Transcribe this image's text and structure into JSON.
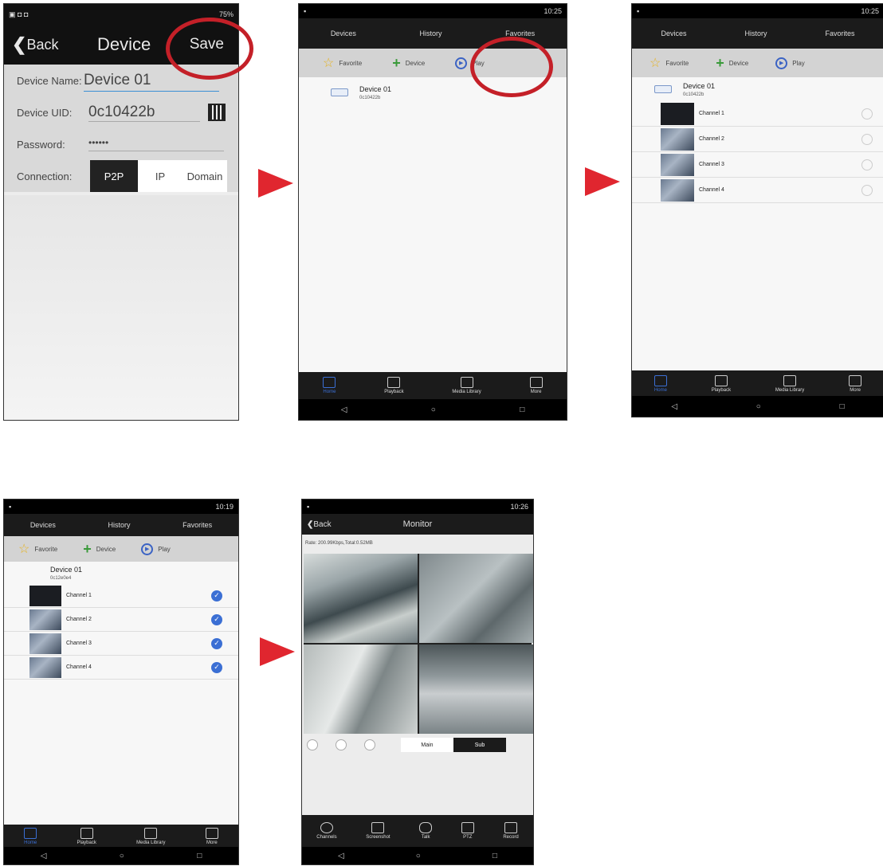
{
  "screen1": {
    "status": "75%",
    "back": "Back",
    "title": "Device",
    "save": "Save",
    "name_label": "Device Name:",
    "name_value": "Device 01",
    "uid_label": "Device UID:",
    "uid_value": "0c10422b",
    "password_label": "Password:",
    "password_value": "••••••",
    "connection_label": "Connection:",
    "conn_options": [
      "P2P",
      "IP",
      "Domain"
    ]
  },
  "screen2": {
    "clock": "10:25",
    "tabs": [
      "Devices",
      "History",
      "Favorites"
    ],
    "favorite": "Favorite",
    "device": "Device",
    "play": "Play",
    "device_name": "Device 01",
    "device_uid": "0c10422b",
    "bottom": [
      "Home",
      "Playback",
      "Media Library",
      "More"
    ]
  },
  "screen3": {
    "clock": "10:25",
    "tabs": [
      "Devices",
      "History",
      "Favorites"
    ],
    "favorite": "Favorite",
    "device": "Device",
    "play": "Play",
    "device_name": "Device 01",
    "device_uid": "0c10422b",
    "channels": [
      "Channel 1",
      "Channel 2",
      "Channel 3",
      "Channel 4"
    ],
    "bottom": [
      "Home",
      "Playback",
      "Media Library",
      "More"
    ]
  },
  "screen4": {
    "clock": "10:19",
    "tabs": [
      "Devices",
      "History",
      "Favorites"
    ],
    "favorite": "Favorite",
    "device": "Device",
    "play": "Play",
    "device_name": "Device 01",
    "device_uid": "0c12e0e4",
    "channels": [
      "Channel 1",
      "Channel 2",
      "Channel 3",
      "Channel 4"
    ],
    "bottom": [
      "Home",
      "Playback",
      "Media Library",
      "More"
    ]
  },
  "screen5": {
    "clock": "10:26",
    "back": "Back",
    "title": "Monitor",
    "rate": "Rate: 200.99Kbps,Total:0.52MB",
    "stream_main": "Main",
    "stream_sub": "Sub",
    "bottom": [
      "Channels",
      "Screenshot",
      "Talk",
      "PTZ",
      "Record"
    ]
  },
  "nav": {
    "back": "◁",
    "home": "○",
    "recent": "□"
  },
  "colors": {
    "accent": "#3b6fd4",
    "highlight_circle": "#c42028",
    "arrow": "#e0262f"
  }
}
